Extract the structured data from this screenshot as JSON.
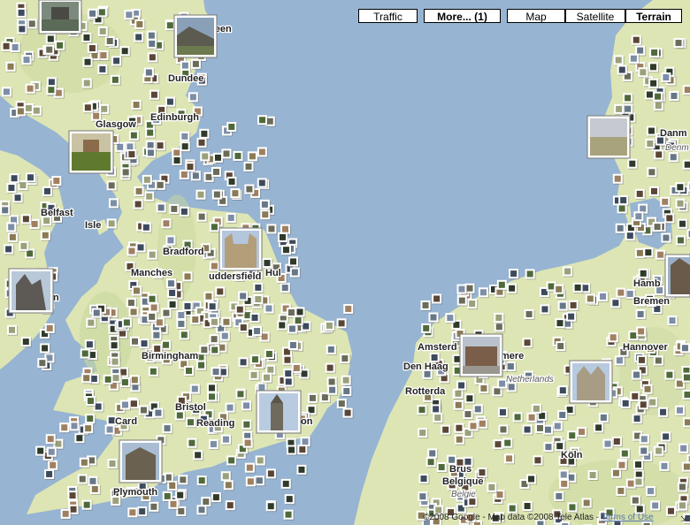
{
  "controls": {
    "traffic": "Traffic",
    "more": "More... (1)",
    "map": "Map",
    "satellite": "Satellite",
    "terrain": "Terrain",
    "active": "terrain"
  },
  "colors": {
    "sea": "#97b4d2",
    "land": "#dde5b4",
    "land_dark": "#c9d79e",
    "photo_border": "#ffffff"
  },
  "place_labels": [
    {
      "name": "Aberdeen",
      "text": "deen"
    },
    {
      "name": "Dundee",
      "text": "Dundee"
    },
    {
      "name": "Edinburgh",
      "text": "Edinburgh"
    },
    {
      "name": "Glasgow",
      "text": "Glasgow"
    },
    {
      "name": "Belfast",
      "text": "Belfast"
    },
    {
      "name": "Isle of Man",
      "text": "Isle"
    },
    {
      "name": "Bradford",
      "text": "Bradford"
    },
    {
      "name": "Manchester",
      "text": "Manches"
    },
    {
      "name": "Huddersfield",
      "text": "uddersfield"
    },
    {
      "name": "Hull",
      "text": "Hul"
    },
    {
      "name": "Dublin",
      "text": "n"
    },
    {
      "name": "Birmingham",
      "text": "Birmingham"
    },
    {
      "name": "Bristol",
      "text": "Bristol"
    },
    {
      "name": "Cardiff",
      "text": "Card"
    },
    {
      "name": "Reading",
      "text": "Reading"
    },
    {
      "name": "London",
      "text": "on"
    },
    {
      "name": "Plymouth",
      "text": "Plymouth"
    },
    {
      "name": "Amsterdam",
      "text": "Amsterd"
    },
    {
      "name": "Almere",
      "text": "mere"
    },
    {
      "name": "Den Haag",
      "text": "Den Haag"
    },
    {
      "name": "Rotterdam",
      "text": "Rotterda"
    },
    {
      "name": "Netherlands",
      "text": "Netherlands"
    },
    {
      "name": "Hannover",
      "text": "Hannover"
    },
    {
      "name": "Hamburg",
      "text": "Hamb"
    },
    {
      "name": "Bremen",
      "text": "Bremen"
    },
    {
      "name": "Denmark",
      "text": "Danm"
    },
    {
      "name": "Danmark",
      "text": "Denm"
    },
    {
      "name": "Koln",
      "text": "Köln"
    },
    {
      "name": "Brussel",
      "text": "Brus"
    },
    {
      "name": "Belgique",
      "text": "Belgique"
    },
    {
      "name": "Belgie",
      "text": "Belgie"
    }
  ],
  "copyright": {
    "text": "©2008 Google - Map data ©2008 Tele Atlas - ",
    "terms": "Terms of Use"
  },
  "photos": [
    {
      "name": "castle-photo"
    },
    {
      "name": "ruined-castle-photo"
    },
    {
      "name": "green-field-photo"
    },
    {
      "name": "coast-photo"
    },
    {
      "name": "cathedral-photo"
    },
    {
      "name": "york-minster-photo"
    },
    {
      "name": "big-ben-photo"
    },
    {
      "name": "exeter-cathedral-photo"
    },
    {
      "name": "amsterdam-building-photo"
    },
    {
      "name": "german-church-photo"
    },
    {
      "name": "denmark-coast-photo"
    },
    {
      "name": "bremen-church-photo"
    }
  ]
}
